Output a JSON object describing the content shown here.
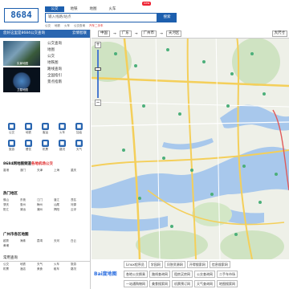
{
  "header": {
    "logo": "8684",
    "tabs": [
      "公交",
      "地铁",
      "地图",
      "火车"
    ],
    "new_badge": "new",
    "search_placeholder": "输入线路/站点",
    "search_button": "搜索",
    "hints": [
      "公交",
      "地铁",
      "火车",
      "公交查询"
    ],
    "hint_red": "汽车二手车"
  },
  "left": {
    "head": "您好这里是8684公交查询",
    "head_right": "云情智联",
    "thumb1_caption": "实景地图",
    "thumb2_caption": "卫星地图",
    "nav": [
      "公交查询",
      "地图",
      "公交",
      "地铁图",
      "路线查询",
      "全国指引",
      "景点指南"
    ],
    "icons": [
      {
        "label": "公交",
        "glyph": "■"
      },
      {
        "label": "地铁",
        "glyph": "■"
      },
      {
        "label": "客运",
        "glyph": "■"
      },
      {
        "label": "火车",
        "glyph": "■"
      },
      {
        "label": "加油",
        "glyph": "■"
      },
      {
        "label": "旅游",
        "glyph": "■"
      },
      {
        "label": "餐饮",
        "glyph": "■"
      },
      {
        "label": "机票",
        "glyph": "■"
      },
      {
        "label": "路况",
        "glyph": "■"
      },
      {
        "label": "天气",
        "glyph": "■"
      }
    ],
    "section1": {
      "title": "8684网地图频道",
      "title_red": "各地机场公交",
      "items": [
        "香港",
        "澳门",
        "天津",
        "上海",
        "重庆"
      ]
    },
    "section2": {
      "title": "热门地区",
      "items": [
        "佛山",
        "东莞",
        "江门",
        "湛江",
        "茂名",
        "肇庆",
        "惠州",
        "梅州",
        "汕尾",
        "河源",
        "阳江",
        "清远",
        "潮州",
        "揭阳",
        "云浮"
      ]
    },
    "section3": {
      "title": "广州市各区地图",
      "items": [
        "越秀",
        "海珠",
        "荔湾",
        "天河",
        "白云",
        "黄埔"
      ]
    },
    "footer": {
      "title": "常用查询",
      "items": [
        "公交",
        "地铁",
        "天气",
        "火车",
        "旅游",
        "机票",
        "酒店",
        "美食",
        "租车",
        "路况"
      ]
    }
  },
  "map": {
    "bar": [
      "中国",
      "→",
      "广东",
      "→",
      "广州市",
      "→",
      "天河区"
    ],
    "right_button": "大尺寸",
    "zoom_in": "+",
    "zoom_out": "−"
  },
  "bottom": {
    "baidu": "Bai度地图",
    "row1": [
      "Linux程序员",
      "学园网",
      "问答资源网",
      "开得搜索网",
      "信息搜索网"
    ],
    "row2": [
      "各地公交换乘",
      "路线查询网",
      "租房买房网",
      "公交查询网",
      "二手车市场"
    ],
    "row3": [
      "一站通购物网",
      "美食搜索网",
      "机票预订网",
      "天气查询网",
      "地图搜索网"
    ]
  }
}
